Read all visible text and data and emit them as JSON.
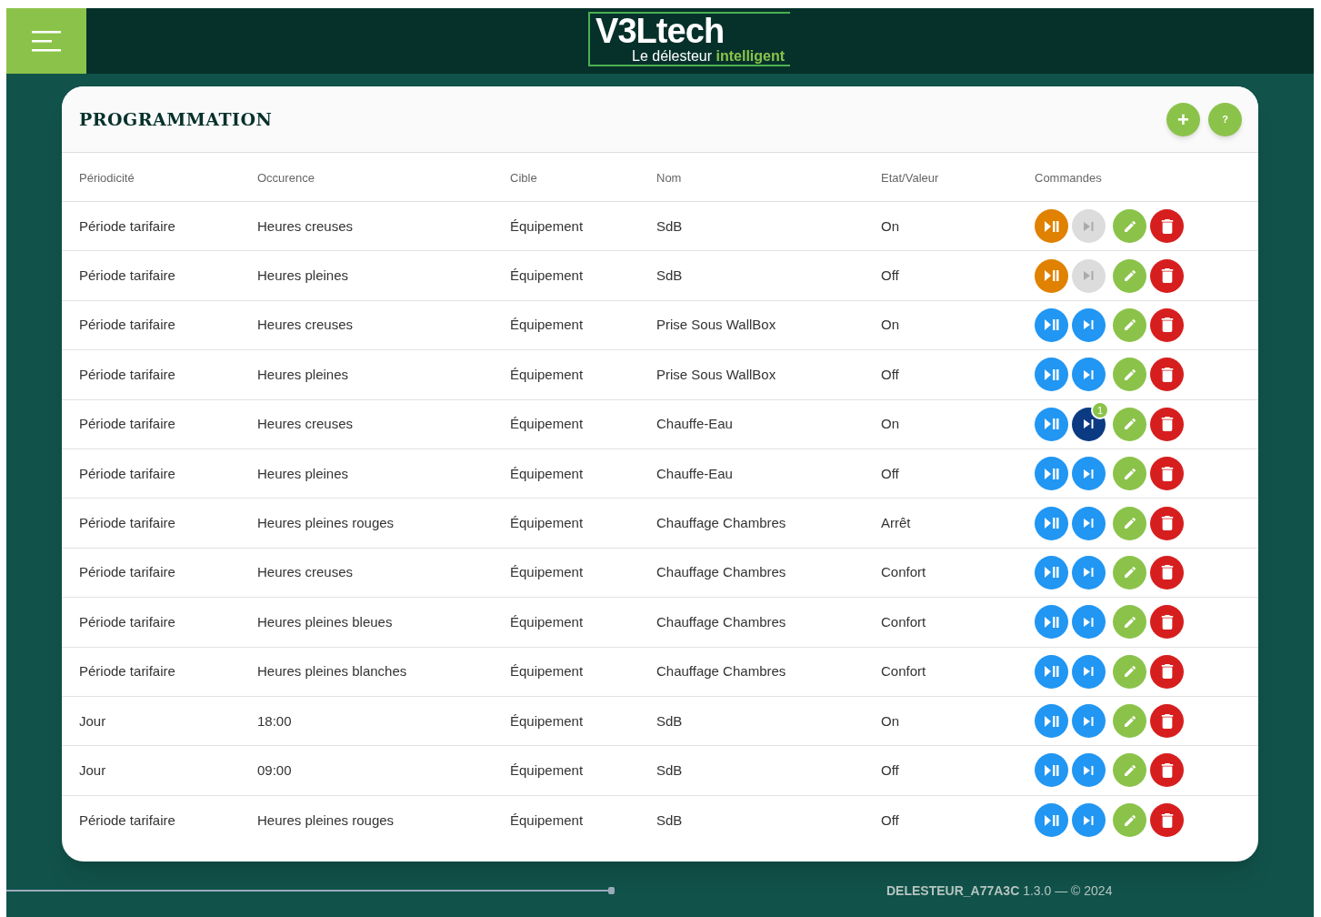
{
  "header": {
    "logo_title": "V3Ltech",
    "logo_tagline": "Le délesteur ",
    "logo_tagline_accent": "intelligent"
  },
  "panel": {
    "title": "PROGRAMMATION",
    "actions": [
      {
        "kind": "add",
        "label": "+"
      },
      {
        "kind": "help",
        "label": "?"
      }
    ]
  },
  "table": {
    "columns": [
      "Périodicité",
      "Occurence",
      "Cible",
      "Nom",
      "Etat/Valeur",
      "Commandes"
    ],
    "rows": [
      {
        "periodicite": "Période tarifaire",
        "occurence": "Heures creuses",
        "cible": "Équipement",
        "nom": "SdB",
        "etat": "On",
        "suspended": true,
        "forced": false
      },
      {
        "periodicite": "Période tarifaire",
        "occurence": "Heures pleines",
        "cible": "Équipement",
        "nom": "SdB",
        "etat": "Off",
        "suspended": true,
        "forced": false
      },
      {
        "periodicite": "Période tarifaire",
        "occurence": "Heures creuses",
        "cible": "Équipement",
        "nom": "Prise Sous WallBox",
        "etat": "On",
        "suspended": false,
        "forced": false
      },
      {
        "periodicite": "Période tarifaire",
        "occurence": "Heures pleines",
        "cible": "Équipement",
        "nom": "Prise Sous WallBox",
        "etat": "Off",
        "suspended": false,
        "forced": false
      },
      {
        "periodicite": "Période tarifaire",
        "occurence": "Heures creuses",
        "cible": "Équipement",
        "nom": "Chauffe-Eau",
        "etat": "On",
        "suspended": false,
        "forced": true,
        "badge": "1"
      },
      {
        "periodicite": "Période tarifaire",
        "occurence": "Heures pleines",
        "cible": "Équipement",
        "nom": "Chauffe-Eau",
        "etat": "Off",
        "suspended": false,
        "forced": false
      },
      {
        "periodicite": "Période tarifaire",
        "occurence": "Heures pleines rouges",
        "cible": "Équipement",
        "nom": "Chauffage Chambres",
        "etat": "Arrêt",
        "suspended": false,
        "forced": false
      },
      {
        "periodicite": "Période tarifaire",
        "occurence": "Heures creuses",
        "cible": "Équipement",
        "nom": "Chauffage Chambres",
        "etat": "Confort",
        "suspended": false,
        "forced": false
      },
      {
        "periodicite": "Période tarifaire",
        "occurence": "Heures pleines bleues",
        "cible": "Équipement",
        "nom": "Chauffage Chambres",
        "etat": "Confort",
        "suspended": false,
        "forced": false
      },
      {
        "periodicite": "Période tarifaire",
        "occurence": "Heures pleines blanches",
        "cible": "Équipement",
        "nom": "Chauffage Chambres",
        "etat": "Confort",
        "suspended": false,
        "forced": false
      },
      {
        "periodicite": "Jour",
        "occurence": "18:00",
        "cible": "Équipement",
        "nom": "SdB",
        "etat": "On",
        "suspended": false,
        "forced": false
      },
      {
        "periodicite": "Jour",
        "occurence": "09:00",
        "cible": "Équipement",
        "nom": "SdB",
        "etat": "Off",
        "suspended": false,
        "forced": false
      },
      {
        "periodicite": "Période tarifaire",
        "occurence": "Heures pleines rouges",
        "cible": "Équipement",
        "nom": "SdB",
        "etat": "Off",
        "suspended": false,
        "forced": false
      }
    ]
  },
  "footer": {
    "device": "DELESTEUR_A77A3C",
    "version": " 1.3.0 — © 2024"
  }
}
